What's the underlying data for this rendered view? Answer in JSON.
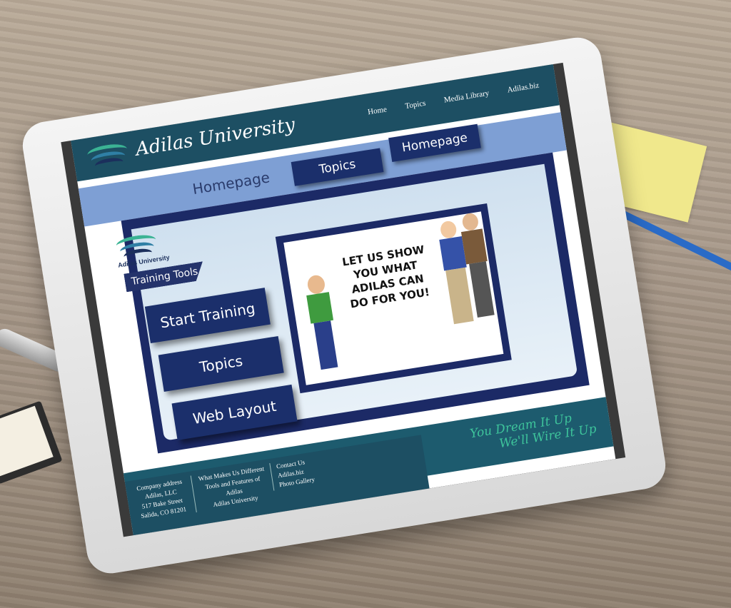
{
  "site": {
    "brand_title": "Adilas University",
    "top_nav": [
      "Home",
      "Topics",
      "Media Library",
      "Adilas.biz"
    ],
    "band": {
      "title": "Homepage",
      "buttons": [
        "Topics",
        "Homepage"
      ]
    },
    "sublogo_name": "Adilas University",
    "training_tab": "Training Tools",
    "main_buttons": [
      "Start Training",
      "Topics",
      "Web Layout"
    ],
    "promo_text": "LET US SHOW YOU WHAT ADILAS CAN DO FOR YOU!",
    "tagline": [
      "You Dream It Up",
      "We'll Wire It Up"
    ],
    "footer": {
      "company": [
        "Company address",
        "Adilas, LLC",
        "517 Bake Street",
        "Salida, CO 81201"
      ],
      "links_mid": [
        "What Makes Us Different",
        "Tools and Features of Adilas",
        "Adilas University"
      ],
      "links_right": [
        "Contact Us",
        "Adilas.biz",
        "Photo Gallery"
      ]
    }
  },
  "colors": {
    "header": "#1d4f63",
    "navy": "#1b2f6b",
    "band": "#7e9fd4",
    "accent_green": "#3ec49b"
  }
}
